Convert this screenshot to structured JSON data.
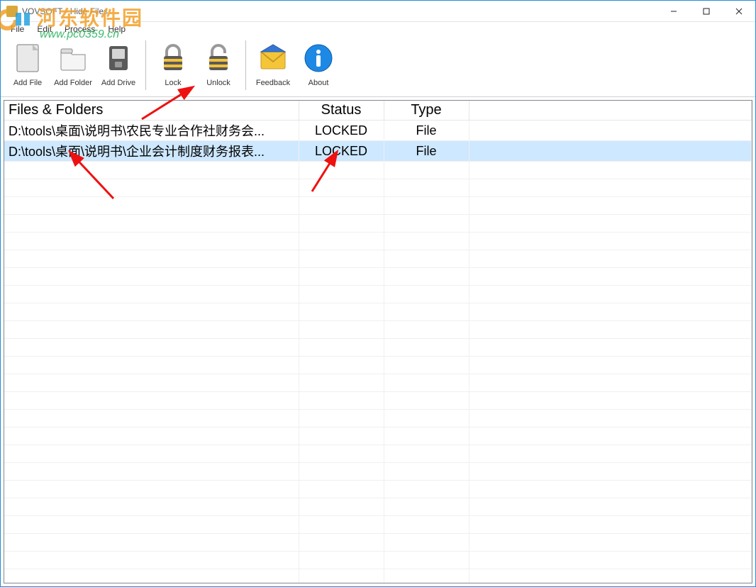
{
  "window": {
    "title": "VOVSOFT - Hide Files"
  },
  "menu": {
    "items": [
      "File",
      "Edit",
      "Process",
      "Help"
    ]
  },
  "toolbar": {
    "buttons": [
      {
        "label": "Add File",
        "icon": "file"
      },
      {
        "label": "Add Folder",
        "icon": "folder"
      },
      {
        "label": "Add Drive",
        "icon": "drive"
      }
    ],
    "buttons2": [
      {
        "label": "Lock",
        "icon": "lock"
      },
      {
        "label": "Unlock",
        "icon": "unlock"
      }
    ],
    "buttons3": [
      {
        "label": "Feedback",
        "icon": "envelope"
      },
      {
        "label": "About",
        "icon": "info"
      }
    ]
  },
  "grid": {
    "headers": {
      "path": "Files & Folders",
      "status": "Status",
      "type": "Type"
    },
    "rows": [
      {
        "path": "D:\\tools\\桌面\\说明书\\农民专业合作社财务会...",
        "status": "LOCKED",
        "type": "File",
        "selected": false
      },
      {
        "path": "D:\\tools\\桌面\\说明书\\企业会计制度财务报表...",
        "status": "LOCKED",
        "type": "File",
        "selected": true
      }
    ]
  },
  "watermark": {
    "line1": "河东软件园",
    "line2": "www.pc0359.cn"
  }
}
